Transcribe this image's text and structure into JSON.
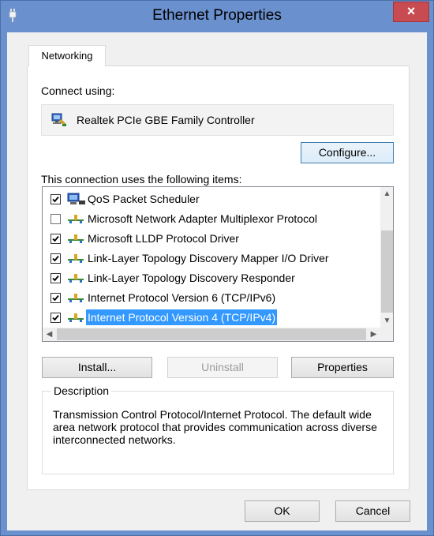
{
  "window": {
    "title": "Ethernet Properties",
    "close_label": "×",
    "accent_color": "#6b90ce",
    "close_color": "#c74b50"
  },
  "tabs": [
    {
      "label": "Networking",
      "selected": true
    }
  ],
  "connect_using": {
    "label": "Connect using:",
    "adapter_name": "Realtek PCIe GBE Family Controller",
    "adapter_icon": "network-adapter-icon"
  },
  "buttons": {
    "configure": "Configure...",
    "install": "Install...",
    "uninstall": "Uninstall",
    "properties": "Properties",
    "ok": "OK",
    "cancel": "Cancel"
  },
  "items_label": "This connection uses the following items:",
  "items": [
    {
      "label": "QoS Packet Scheduler",
      "checked": true,
      "icon": "scheduler-icon"
    },
    {
      "label": "Microsoft Network Adapter Multiplexor Protocol",
      "checked": false,
      "icon": "protocol-icon"
    },
    {
      "label": "Microsoft LLDP Protocol Driver",
      "checked": true,
      "icon": "protocol-icon"
    },
    {
      "label": "Link-Layer Topology Discovery Mapper I/O Driver",
      "checked": true,
      "icon": "protocol-icon"
    },
    {
      "label": "Link-Layer Topology Discovery Responder",
      "checked": true,
      "icon": "protocol-icon"
    },
    {
      "label": "Internet Protocol Version 6 (TCP/IPv6)",
      "checked": true,
      "icon": "protocol-icon"
    },
    {
      "label": "Internet Protocol Version 4 (TCP/IPv4)",
      "checked": true,
      "icon": "protocol-icon",
      "selected": true
    }
  ],
  "description": {
    "title": "Description",
    "text": "Transmission Control Protocol/Internet Protocol. The default wide area network protocol that provides communication across diverse interconnected networks."
  },
  "selection_color": "#3399ff"
}
